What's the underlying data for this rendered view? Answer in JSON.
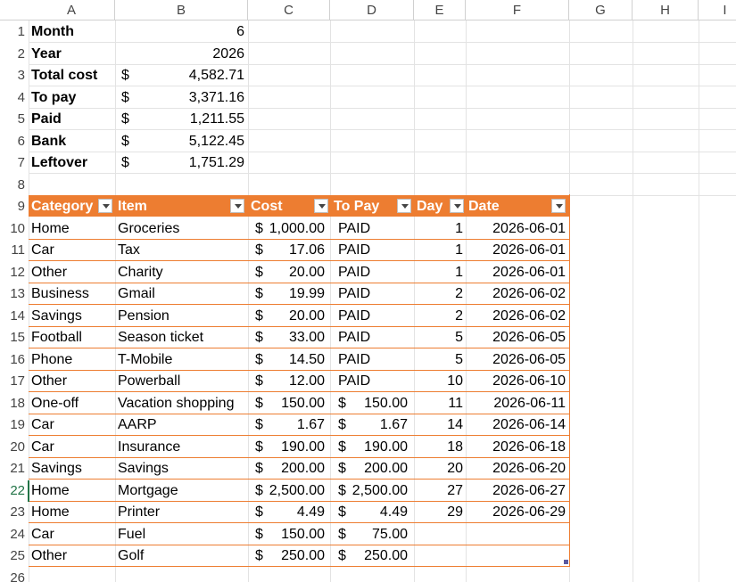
{
  "columns": [
    "A",
    "B",
    "C",
    "D",
    "E",
    "F",
    "G",
    "H",
    "I"
  ],
  "rows": [
    "1",
    "2",
    "3",
    "4",
    "5",
    "6",
    "7",
    "8",
    "9",
    "10",
    "11",
    "12",
    "13",
    "14",
    "15",
    "16",
    "17",
    "18",
    "19",
    "20",
    "21",
    "22",
    "23",
    "24",
    "25",
    "26"
  ],
  "summary": [
    {
      "label": "Month",
      "dollar": "",
      "value": "6"
    },
    {
      "label": "Year",
      "dollar": "",
      "value": "2026"
    },
    {
      "label": "Total cost",
      "dollar": "$",
      "value": "4,582.71"
    },
    {
      "label": "To pay",
      "dollar": "$",
      "value": "3,371.16"
    },
    {
      "label": "Paid",
      "dollar": "$",
      "value": "1,211.55"
    },
    {
      "label": "Bank",
      "dollar": "$",
      "value": "5,122.45"
    },
    {
      "label": "Leftover",
      "dollar": "$",
      "value": "1,751.29"
    }
  ],
  "table": {
    "headers": {
      "category": "Category",
      "item": "Item",
      "cost": "Cost",
      "topay": "To Pay",
      "day": "Day",
      "date": "Date"
    },
    "rows": [
      {
        "category": "Home",
        "item": "Groceries",
        "cost_sym": "$",
        "cost": "1,000.00",
        "pay_sym": "",
        "pay": "PAID",
        "day": "1",
        "date": "2026-06-01"
      },
      {
        "category": "Car",
        "item": "Tax",
        "cost_sym": "$",
        "cost": "17.06",
        "pay_sym": "",
        "pay": "PAID",
        "day": "1",
        "date": "2026-06-01"
      },
      {
        "category": "Other",
        "item": "Charity",
        "cost_sym": "$",
        "cost": "20.00",
        "pay_sym": "",
        "pay": "PAID",
        "day": "1",
        "date": "2026-06-01"
      },
      {
        "category": "Business",
        "item": "Gmail",
        "cost_sym": "$",
        "cost": "19.99",
        "pay_sym": "",
        "pay": "PAID",
        "day": "2",
        "date": "2026-06-02"
      },
      {
        "category": "Savings",
        "item": "Pension",
        "cost_sym": "$",
        "cost": "20.00",
        "pay_sym": "",
        "pay": "PAID",
        "day": "2",
        "date": "2026-06-02"
      },
      {
        "category": "Football",
        "item": "Season ticket",
        "cost_sym": "$",
        "cost": "33.00",
        "pay_sym": "",
        "pay": "PAID",
        "day": "5",
        "date": "2026-06-05"
      },
      {
        "category": "Phone",
        "item": "T-Mobile",
        "cost_sym": "$",
        "cost": "14.50",
        "pay_sym": "",
        "pay": "PAID",
        "day": "5",
        "date": "2026-06-05"
      },
      {
        "category": "Other",
        "item": "Powerball",
        "cost_sym": "$",
        "cost": "12.00",
        "pay_sym": "",
        "pay": "PAID",
        "day": "10",
        "date": "2026-06-10"
      },
      {
        "category": "One-off",
        "item": "Vacation shopping",
        "cost_sym": "$",
        "cost": "150.00",
        "pay_sym": "$",
        "pay": "150.00",
        "day": "11",
        "date": "2026-06-11"
      },
      {
        "category": "Car",
        "item": "AARP",
        "cost_sym": "$",
        "cost": "1.67",
        "pay_sym": "$",
        "pay": "1.67",
        "day": "14",
        "date": "2026-06-14"
      },
      {
        "category": "Car",
        "item": "Insurance",
        "cost_sym": "$",
        "cost": "190.00",
        "pay_sym": "$",
        "pay": "190.00",
        "day": "18",
        "date": "2026-06-18"
      },
      {
        "category": "Savings",
        "item": "Savings",
        "cost_sym": "$",
        "cost": "200.00",
        "pay_sym": "$",
        "pay": "200.00",
        "day": "20",
        "date": "2026-06-20"
      },
      {
        "category": "Home",
        "item": "Mortgage",
        "cost_sym": "$",
        "cost": "2,500.00",
        "pay_sym": "$",
        "pay": "2,500.00",
        "day": "27",
        "date": "2026-06-27"
      },
      {
        "category": "Home",
        "item": "Printer",
        "cost_sym": "$",
        "cost": "4.49",
        "pay_sym": "$",
        "pay": "4.49",
        "day": "29",
        "date": "2026-06-29"
      },
      {
        "category": "Car",
        "item": "Fuel",
        "cost_sym": "$",
        "cost": "150.00",
        "pay_sym": "$",
        "pay": "75.00",
        "day": "",
        "date": ""
      },
      {
        "category": "Other",
        "item": "Golf",
        "cost_sym": "$",
        "cost": "250.00",
        "pay_sym": "$",
        "pay": "250.00",
        "day": "",
        "date": ""
      }
    ]
  },
  "colors": {
    "accent": "#ed7d31",
    "selected_row": "#217346"
  }
}
